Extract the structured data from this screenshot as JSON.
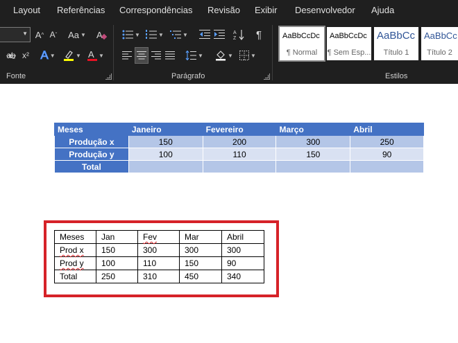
{
  "ribbon": {
    "tabs": [
      "Layout",
      "Referências",
      "Correspondências",
      "Revisão",
      "Exibir",
      "Desenvolvedor",
      "Ajuda"
    ],
    "groups": {
      "font": "Fonte",
      "paragraph": "Parágrafo",
      "styles": "Estilos"
    },
    "font_controls": {
      "grow": "A",
      "shrink": "A",
      "change_case": "Aa",
      "subscript": "x₂",
      "superscript": "x²",
      "text_effects": "A",
      "font_color": "A"
    },
    "styles": [
      {
        "preview": "AaBbCcDc",
        "name": "¶ Normal"
      },
      {
        "preview": "AaBbCcDc",
        "name": "¶ Sem Esp..."
      },
      {
        "preview": "AaBbCc",
        "name": "Título 1"
      },
      {
        "preview": "AaBbCc",
        "name": "Título 2"
      }
    ],
    "colors": {
      "highlight": "#ffff00",
      "font_color": "#e81123",
      "text_effects": "#3a86ff"
    }
  },
  "doc": {
    "table1": {
      "headers": [
        "Meses",
        "Janeiro",
        "Fevereiro",
        "Março",
        "Abril"
      ],
      "rows": [
        {
          "label": "Produção x",
          "values": [
            "150",
            "200",
            "300",
            "250"
          ]
        },
        {
          "label": "Produção y",
          "values": [
            "100",
            "110",
            "150",
            "90"
          ]
        },
        {
          "label": "Total",
          "values": [
            "",
            "",
            "",
            ""
          ]
        }
      ],
      "colors": {
        "header": "#4472c4",
        "band1": "#b4c6e7",
        "band2": "#d9e1f2"
      }
    },
    "table2": {
      "rows": [
        [
          "Meses",
          "Jan",
          "Fev",
          "Mar",
          "Abril"
        ],
        [
          "Prod x",
          "150",
          "300",
          "300",
          "300"
        ],
        [
          "Prod y",
          "100",
          "110",
          "150",
          "90"
        ],
        [
          "Total",
          "250",
          "310",
          "450",
          "340"
        ]
      ],
      "highlight_color": "#d62228"
    }
  }
}
